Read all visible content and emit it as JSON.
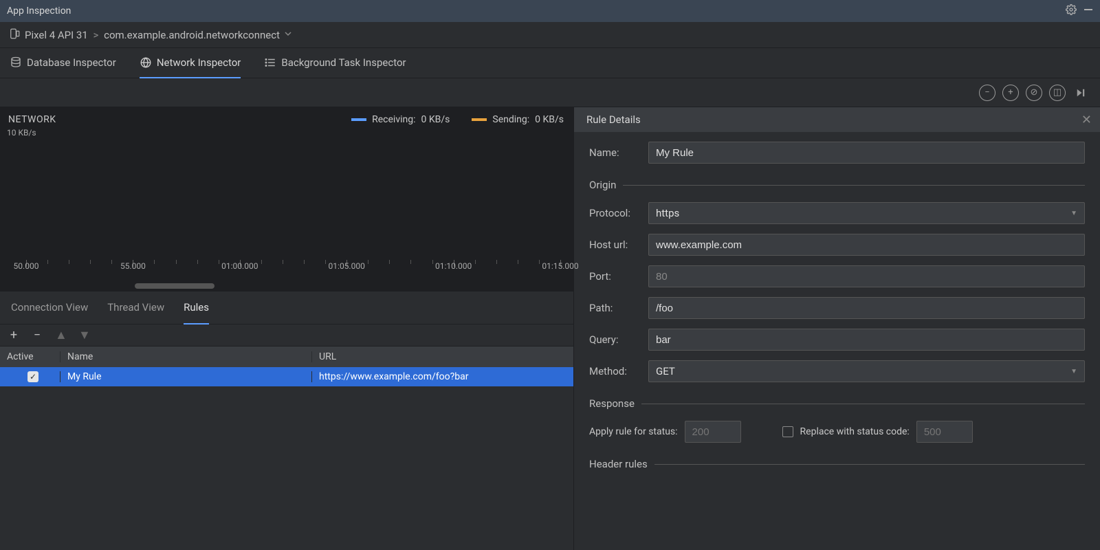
{
  "title_bar": {
    "title": "App Inspection"
  },
  "breadcrumb": {
    "device": "Pixel 4 API 31",
    "app": "com.example.android.networkconnect"
  },
  "inspector_tabs": {
    "database": "Database Inspector",
    "network": "Network Inspector",
    "background": "Background Task Inspector",
    "active": "network"
  },
  "network_panel": {
    "title": "NETWORK",
    "y_label": "10 KB/s",
    "legend": {
      "receiving": {
        "label": "Receiving:",
        "value": "0 KB/s"
      },
      "sending": {
        "label": "Sending:",
        "value": "0 KB/s"
      }
    },
    "timeline": {
      "labels": [
        "50.000",
        "55.000",
        "01:00.000",
        "01:05.000",
        "01:10.000",
        "01:15.000"
      ]
    }
  },
  "sub_tabs": {
    "connection": "Connection View",
    "thread": "Thread View",
    "rules": "Rules",
    "active": "rules"
  },
  "rules_table": {
    "headers": {
      "active": "Active",
      "name": "Name",
      "url": "URL"
    },
    "rows": [
      {
        "active": true,
        "name": "My Rule",
        "url": "https://www.example.com/foo?bar"
      }
    ]
  },
  "rule_details": {
    "header": "Rule Details",
    "name_label": "Name:",
    "name_value": "My Rule",
    "sections": {
      "origin": "Origin",
      "response": "Response",
      "header_rules": "Header rules"
    },
    "origin": {
      "protocol_label": "Protocol:",
      "protocol_value": "https",
      "host_label": "Host url:",
      "host_value": "www.example.com",
      "port_label": "Port:",
      "port_placeholder": "80",
      "path_label": "Path:",
      "path_value": "/foo",
      "query_label": "Query:",
      "query_value": "bar",
      "method_label": "Method:",
      "method_value": "GET"
    },
    "response": {
      "apply_label": "Apply rule for status:",
      "apply_placeholder": "200",
      "replace_label": "Replace with status code:",
      "replace_placeholder": "500"
    }
  }
}
